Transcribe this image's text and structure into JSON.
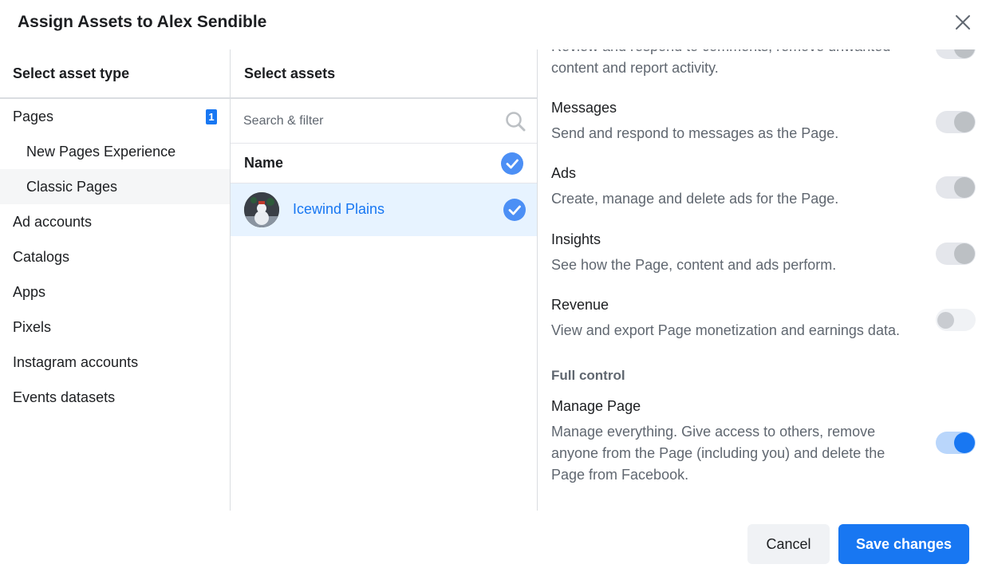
{
  "dialog": {
    "title": "Assign Assets to Alex Sendible"
  },
  "asset_types": {
    "heading": "Select asset type",
    "items": [
      {
        "label": "Pages",
        "badge": "1"
      },
      {
        "label": "New Pages Experience"
      },
      {
        "label": "Classic Pages"
      },
      {
        "label": "Ad accounts"
      },
      {
        "label": "Catalogs"
      },
      {
        "label": "Apps"
      },
      {
        "label": "Pixels"
      },
      {
        "label": "Instagram accounts"
      },
      {
        "label": "Events datasets"
      }
    ],
    "selected": "Classic Pages"
  },
  "assets": {
    "heading": "Select assets",
    "search_placeholder": "Search & filter",
    "name_header": "Name",
    "rows": [
      {
        "name": "Icewind Plains",
        "selected": true
      }
    ]
  },
  "permissions": {
    "items": [
      {
        "title": "",
        "desc": "Review and respond to comments, remove unwanted content and report activity.",
        "state": "on-disabled"
      },
      {
        "title": "Messages",
        "desc": "Send and respond to messages as the Page.",
        "state": "on-disabled"
      },
      {
        "title": "Ads",
        "desc": "Create, manage and delete ads for the Page.",
        "state": "on-disabled"
      },
      {
        "title": "Insights",
        "desc": "See how the Page, content and ads perform.",
        "state": "on-disabled"
      },
      {
        "title": "Revenue",
        "desc": "View and export Page monetization and earnings data.",
        "state": "off-disabled"
      }
    ],
    "full_control_label": "Full control",
    "full_control": {
      "title": "Manage Page",
      "desc": "Manage everything. Give access to others, remove anyone from the Page (including you) and delete the Page from Facebook.",
      "state": "on"
    }
  },
  "footer": {
    "cancel_label": "Cancel",
    "save_label": "Save changes"
  },
  "colors": {
    "accent": "#1877f2",
    "selected_row": "#e7f3ff",
    "check": "#4c8ff5"
  }
}
